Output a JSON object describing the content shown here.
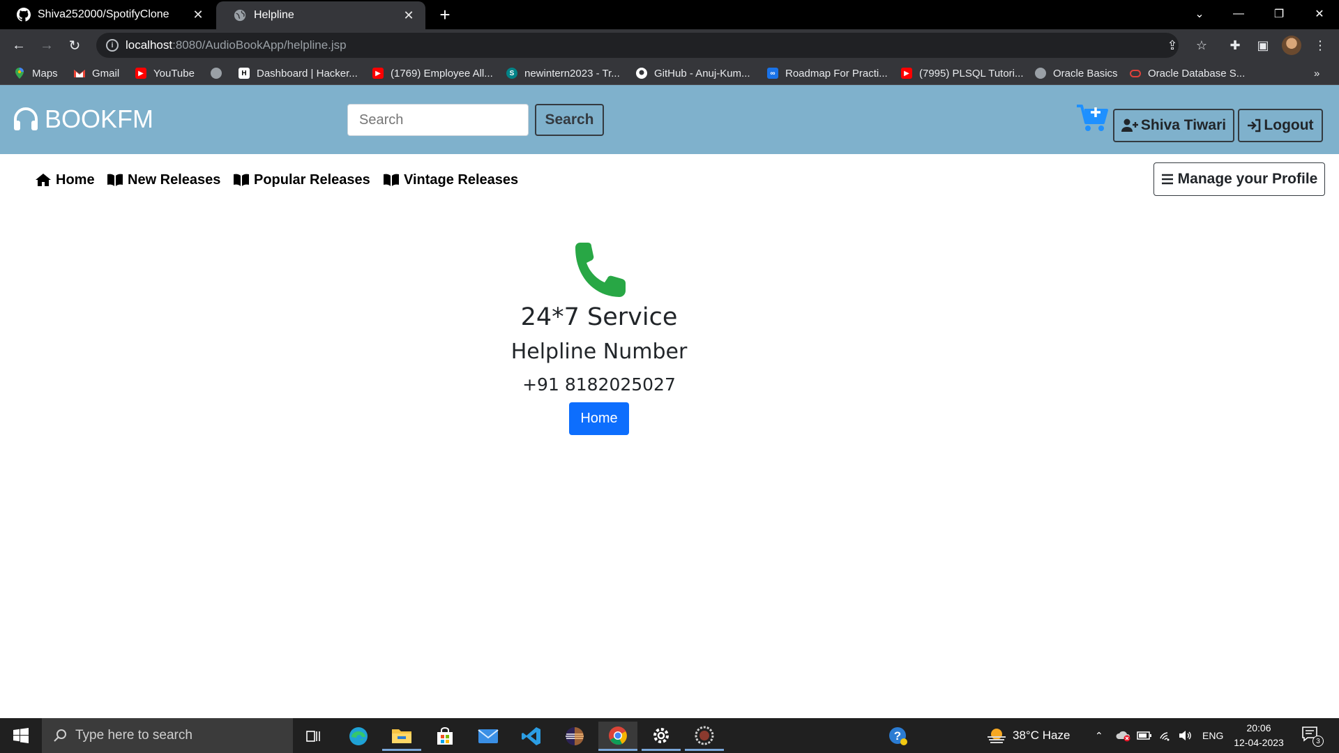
{
  "browser": {
    "tabs": [
      {
        "title": "Shiva252000/SpotifyClone",
        "icon": "github-icon",
        "active": false
      },
      {
        "title": "Helpline",
        "icon": "globe-icon",
        "active": true
      }
    ],
    "address": {
      "host": "localhost",
      "rest": ":8080/AudioBookApp/helpline.jsp"
    },
    "bookmarks": [
      {
        "label": "Maps",
        "icon": "maps-icon"
      },
      {
        "label": "Gmail",
        "icon": "gmail-icon"
      },
      {
        "label": "YouTube",
        "icon": "youtube-icon"
      },
      {
        "label": "",
        "icon": "globe-icon"
      },
      {
        "label": "Dashboard | Hacker...",
        "icon": "hackerrank-icon"
      },
      {
        "label": "(1769) Employee All...",
        "icon": "youtube-icon"
      },
      {
        "label": "newintern2023 - Tr...",
        "icon": "sharepoint-icon"
      },
      {
        "label": "GitHub - Anuj-Kum...",
        "icon": "github-icon"
      },
      {
        "label": "Roadmap For Practi...",
        "icon": "roadmap-icon"
      },
      {
        "label": "(7995) PLSQL Tutori...",
        "icon": "youtube-icon"
      },
      {
        "label": "Oracle Basics",
        "icon": "globe-icon"
      },
      {
        "label": "Oracle Database S...",
        "icon": "oracle-icon"
      }
    ],
    "more_bookmarks": "»"
  },
  "header": {
    "brand": "BOOKFM",
    "search_placeholder": "Search",
    "search_button": "Search",
    "user_button": "Shiva Tiwari",
    "logout_button": "Logout"
  },
  "nav": {
    "links": [
      "Home",
      "New Releases",
      "Popular Releases",
      "Vintage Releases"
    ],
    "manage_profile": "Manage your Profile"
  },
  "helpline": {
    "title": "24*7 Service",
    "subtitle": "Helpline Number",
    "number": "+91 8182025027",
    "home_button": "Home",
    "phone_color": "#28a745"
  },
  "taskbar": {
    "search_placeholder": "Type here to search",
    "weather": "38°C  Haze",
    "language": "ENG",
    "time": "20:06",
    "date": "12-04-2023",
    "notification_count": "3"
  },
  "colors": {
    "header_bg": "#7fb1cc",
    "cart": "#1e90ff",
    "home_button": "#0d6efd"
  }
}
